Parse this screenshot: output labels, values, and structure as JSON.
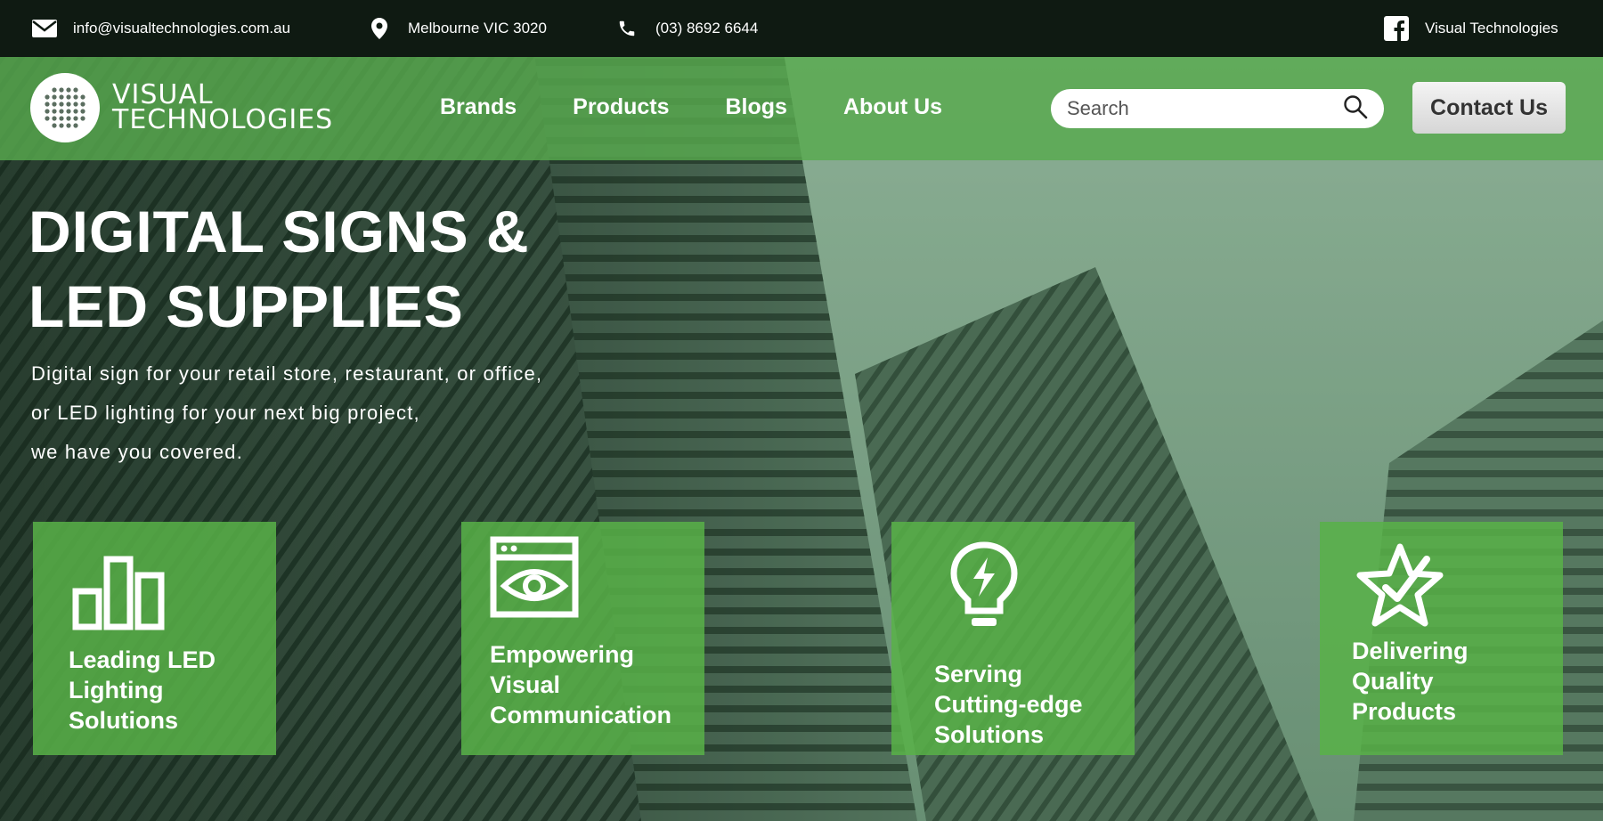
{
  "topbar": {
    "email": "info@visualtechnologies.com.au",
    "location": "Melbourne VIC 3020",
    "phone": "(03) 8692 6644",
    "facebook": "Visual Technologies"
  },
  "logo": {
    "line1": "VISUAL",
    "line2": "TECHNOLOGIES"
  },
  "nav": {
    "items": [
      "Brands",
      "Products",
      "Blogs",
      "About Us"
    ]
  },
  "search": {
    "placeholder": "Search"
  },
  "contact_button": "Contact Us",
  "hero": {
    "title_line1": "DIGITAL SIGNS &",
    "title_line2": "LED SUPPLIES",
    "sub_line1": "Digital sign for your retail store, restaurant, or office,",
    "sub_line2": "or LED lighting for your next big project,",
    "sub_line3": "we have you covered."
  },
  "features": [
    {
      "icon": "bar-chart-icon",
      "lines": [
        "Leading LED",
        "Lighting",
        "Solutions"
      ]
    },
    {
      "icon": "eye-window-icon",
      "lines": [
        "Empowering",
        "Visual",
        "Communication"
      ]
    },
    {
      "icon": "lightbulb-bolt-icon",
      "lines": [
        "Serving",
        "Cutting-edge",
        "Solutions"
      ]
    },
    {
      "icon": "star-check-icon",
      "lines": [
        "Delivering",
        "Quality",
        "Products"
      ]
    }
  ],
  "colors": {
    "topbar": "#0f1a12",
    "brand_green": "#58aa4e",
    "feature_green": "#58b248"
  }
}
